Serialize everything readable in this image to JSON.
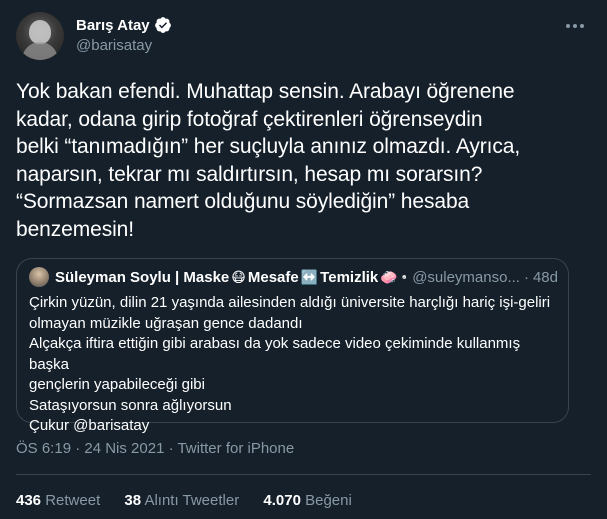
{
  "author": {
    "display_name": "Barış Atay",
    "handle": "@barisatay"
  },
  "tweet": {
    "lines": [
      "Yok bakan efendi. Muhattap sensin. Arabayı öğrenene",
      "kadar, odana girip fotoğraf çektirenleri öğrenseydin",
      "belki “tanımadığın” her suçluyla anınız olmazdı. Ayrıca,",
      "naparsın, tekrar mı saldırtırsın, hesap mı sorarsın?",
      "“Sormazsan namert olduğunu söylediğin” hesaba",
      "benzemesin!"
    ]
  },
  "quoted": {
    "name_part1": "Süleyman Soylu | Maske",
    "emoji1": "😷",
    "name_part2": "Mesafe",
    "emoji2": "↔️",
    "name_part3": "Temizlik",
    "emoji3": "🧼",
    "handle": "@suleymanso...",
    "dot": "·",
    "time": "48d",
    "lines": [
      "Çirkin yüzün, dilin 21 yaşında ailesinden aldığı üniversite harçlığı hariç işi-geliri",
      "olmayan müzikle uğraşan gence dadandı",
      "Alçakça iftira ettiğin gibi arabası da yok sadece video çekiminde kullanmış başka",
      "gençlerin yapabileceği gibi",
      "Sataşıyorsun sonra ağlıyorsun",
      "Çukur @barisatay"
    ]
  },
  "meta": {
    "text": "ÖS 6:19 · 24 Nis 2021 · Twitter for iPhone"
  },
  "stats": {
    "retweets_num": "436",
    "retweets_label": "Retweet",
    "quotes_num": "38",
    "quotes_label": "Alıntı Tweetler",
    "likes_num": "4.070",
    "likes_label": "Beğeni"
  },
  "colors": {
    "background": "#15202b",
    "secondary_text": "#8899a6",
    "border": "#38444d",
    "verified": "#1da1f2"
  },
  "icons": [
    "verified-badge-icon",
    "more-options-icon"
  ]
}
